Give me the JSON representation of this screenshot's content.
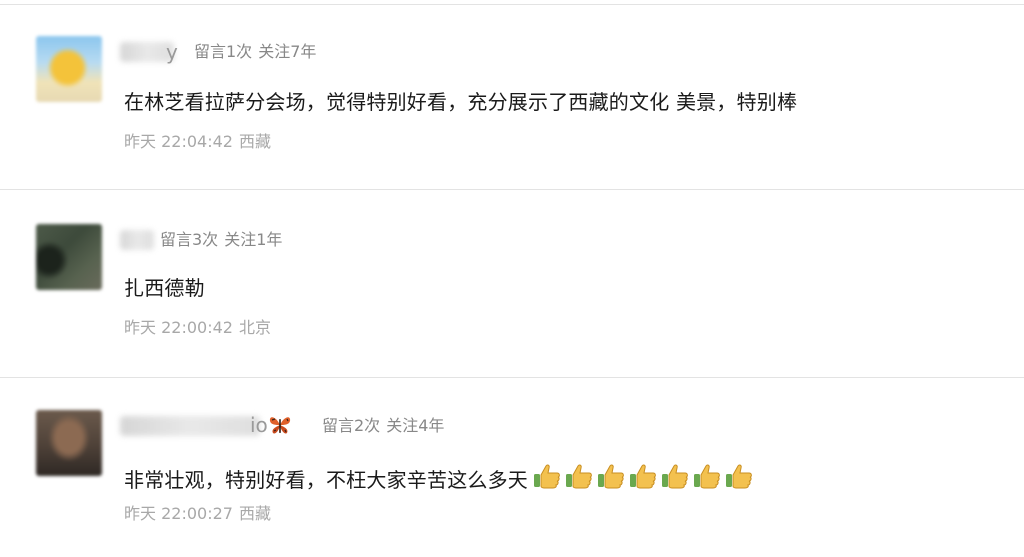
{
  "comments": [
    {
      "name_visible": "y",
      "messages": "留言1次",
      "follow": "关注7年",
      "text": "在林芝看拉萨分会场，觉得特别好看，充分展示了西藏的文化 美景，特别棒",
      "time": "昨天 22:04:42",
      "location": "西藏",
      "avatar_icon": "sunny-landscape-avatar-icon"
    },
    {
      "name_visible": "",
      "messages": "留言3次",
      "follow": "关注1年",
      "text": "扎西德勒",
      "time": "昨天 22:00:42",
      "location": "北京",
      "avatar_icon": "dark-forest-avatar-icon"
    },
    {
      "name_visible": "io",
      "name_emoji": "butterfly-icon",
      "messages": "留言2次",
      "follow": "关注4年",
      "text": "非常壮观，特别好看，不枉大家辛苦这么多天",
      "thumbs_count": 7,
      "thumbs_icon": "thumbs-up-icon",
      "time": "昨天 22:00:27",
      "location": "西藏",
      "avatar_icon": "portrait-avatar-icon"
    }
  ],
  "colors": {
    "text": "#1a1a1a",
    "meta": "#888888",
    "time": "#a8a8a8",
    "divider": "#e3e3e3",
    "thumb": "#f3c14f"
  }
}
